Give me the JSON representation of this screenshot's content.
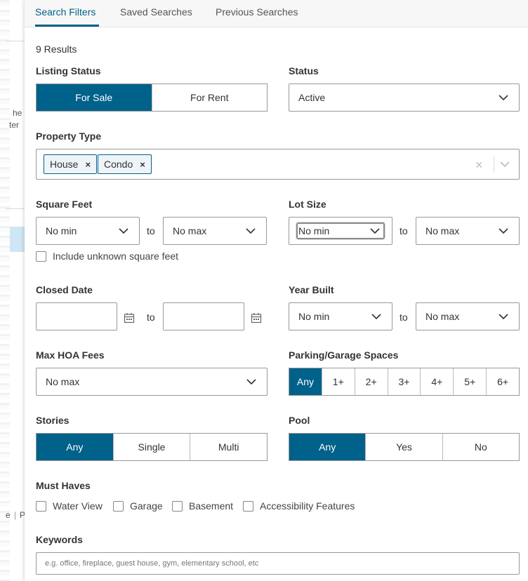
{
  "background_fragments": [
    "he",
    "ter",
    "e",
    "|",
    "P"
  ],
  "tabs": [
    {
      "label": "Search Filters",
      "active": true
    },
    {
      "label": "Saved Searches"
    },
    {
      "label": "Previous Searches"
    }
  ],
  "results_text": "9 Results",
  "listing_status": {
    "label": "Listing Status",
    "options": [
      "For Sale",
      "For Rent"
    ],
    "selected": "For Sale"
  },
  "status": {
    "label": "Status",
    "value": "Active"
  },
  "property_type": {
    "label": "Property Type",
    "chips": [
      "House",
      "Condo"
    ],
    "remove_glyph": "×",
    "clear_glyph": "×"
  },
  "square_feet": {
    "label": "Square Feet",
    "min": "No min",
    "max": "No max",
    "to": "to",
    "unknown_label": "Include unknown square feet"
  },
  "lot_size": {
    "label": "Lot Size",
    "min": "No min",
    "max": "No max",
    "to": "to"
  },
  "closed_date": {
    "label": "Closed Date",
    "to": "to"
  },
  "year_built": {
    "label": "Year Built",
    "min": "No min",
    "max": "No max",
    "to": "to"
  },
  "max_hoa": {
    "label": "Max HOA Fees",
    "value": "No max"
  },
  "parking": {
    "label": "Parking/Garage Spaces",
    "options": [
      "Any",
      "1+",
      "2+",
      "3+",
      "4+",
      "5+",
      "6+"
    ],
    "selected": "Any"
  },
  "stories": {
    "label": "Stories",
    "options": [
      "Any",
      "Single",
      "Multi"
    ],
    "selected": "Any"
  },
  "pool": {
    "label": "Pool",
    "options": [
      "Any",
      "Yes",
      "No"
    ],
    "selected": "Any"
  },
  "must_haves": {
    "label": "Must Haves",
    "options": [
      "Water View",
      "Garage",
      "Basement",
      "Accessibility Features"
    ]
  },
  "keywords": {
    "label": "Keywords",
    "placeholder": "e.g. office, fireplace, guest house, gym, elementary school, etc"
  },
  "colors": {
    "accent": "#00618a",
    "border": "#999999"
  }
}
